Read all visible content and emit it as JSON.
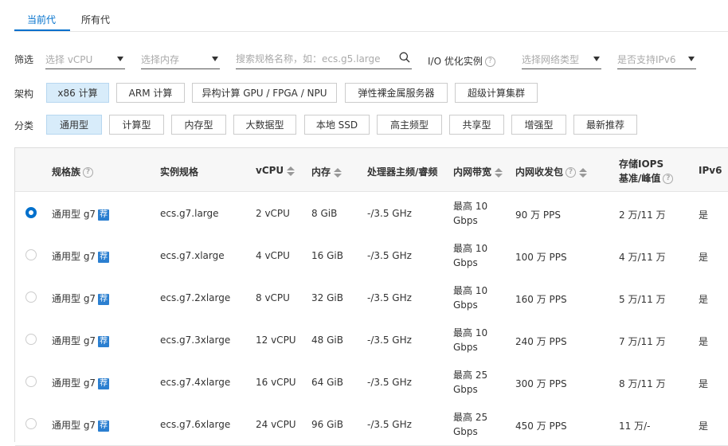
{
  "tabs": [
    {
      "label": "当前代",
      "active": true
    },
    {
      "label": "所有代",
      "active": false
    }
  ],
  "filter": {
    "label": "筛选",
    "vcpu_placeholder": "选择 vCPU",
    "memory_placeholder": "选择内存",
    "search_placeholder": "搜索规格名称，如：ecs.g5.large",
    "io_label": "I/O 优化实例",
    "network_placeholder": "选择网络类型",
    "ipv6_placeholder": "是否支持IPv6"
  },
  "arch": {
    "label": "架构",
    "options": [
      "x86 计算",
      "ARM 计算",
      "异构计算 GPU / FPGA / NPU",
      "弹性裸金属服务器",
      "超级计算集群"
    ],
    "selected": 0
  },
  "category": {
    "label": "分类",
    "options": [
      "通用型",
      "计算型",
      "内存型",
      "大数据型",
      "本地 SSD",
      "高主频型",
      "共享型",
      "增强型",
      "最新推荐"
    ],
    "selected": 0
  },
  "table": {
    "headers": {
      "family": "规格族",
      "spec": "实例规格",
      "vcpu": "vCPU",
      "memory": "内存",
      "cpu_freq": "处理器主频/睿频",
      "bandwidth": "内网带宽",
      "pps": "内网收发包",
      "iops_line1": "存储IOPS",
      "iops_line2": "基准/峰值",
      "ipv6": "IPv6"
    },
    "tag_label": "荐",
    "rows": [
      {
        "family": "通用型 g7",
        "spec": "ecs.g7.large",
        "vcpu": "2 vCPU",
        "memory": "8 GiB",
        "freq": "-/3.5 GHz",
        "bw1": "最高 10",
        "bw2": "Gbps",
        "pps": "90 万 PPS",
        "iops": "2 万/11 万",
        "ipv6": "是",
        "checked": true
      },
      {
        "family": "通用型 g7",
        "spec": "ecs.g7.xlarge",
        "vcpu": "4 vCPU",
        "memory": "16 GiB",
        "freq": "-/3.5 GHz",
        "bw1": "最高 10",
        "bw2": "Gbps",
        "pps": "100 万 PPS",
        "iops": "4 万/11 万",
        "ipv6": "是",
        "checked": false
      },
      {
        "family": "通用型 g7",
        "spec": "ecs.g7.2xlarge",
        "vcpu": "8 vCPU",
        "memory": "32 GiB",
        "freq": "-/3.5 GHz",
        "bw1": "最高 10",
        "bw2": "Gbps",
        "pps": "160 万 PPS",
        "iops": "5 万/11 万",
        "ipv6": "是",
        "checked": false
      },
      {
        "family": "通用型 g7",
        "spec": "ecs.g7.3xlarge",
        "vcpu": "12 vCPU",
        "memory": "48 GiB",
        "freq": "-/3.5 GHz",
        "bw1": "最高 10",
        "bw2": "Gbps",
        "pps": "240 万 PPS",
        "iops": "7 万/11 万",
        "ipv6": "是",
        "checked": false
      },
      {
        "family": "通用型 g7",
        "spec": "ecs.g7.4xlarge",
        "vcpu": "16 vCPU",
        "memory": "64 GiB",
        "freq": "-/3.5 GHz",
        "bw1": "最高 25",
        "bw2": "Gbps",
        "pps": "300 万 PPS",
        "iops": "8 万/11 万",
        "ipv6": "是",
        "checked": false
      },
      {
        "family": "通用型 g7",
        "spec": "ecs.g7.6xlarge",
        "vcpu": "24 vCPU",
        "memory": "96 GiB",
        "freq": "-/3.5 GHz",
        "bw1": "最高 25",
        "bw2": "Gbps",
        "pps": "450 万 PPS",
        "iops": "11 万/-",
        "ipv6": "是",
        "checked": false
      }
    ]
  },
  "colors": {
    "accent": "#0070cc",
    "selected_chip_bg": "#d8ecfa",
    "tag_bg": "#2b7fd0"
  }
}
